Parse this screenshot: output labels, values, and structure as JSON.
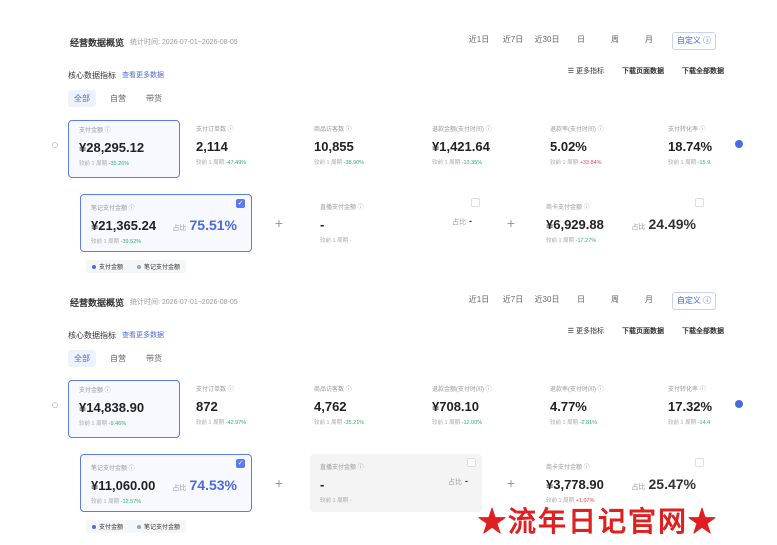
{
  "panels": [
    {
      "title": "经营数据概览",
      "stat_range": "统计时间: 2026-07-01~2026-08-05",
      "range_buttons": [
        "近1日",
        "近7日",
        "近30日",
        "日",
        "周",
        "月"
      ],
      "custom_button": "自定义 ⓘ",
      "sub_title": "核心数据指标",
      "sub_link": "查看更多数据",
      "actions": {
        "more_metrics": "☰ 更多指标",
        "download_page": "下载页面数据",
        "download_all": "下载全部数据"
      },
      "tabs": [
        "全部",
        "自营",
        "带货"
      ],
      "metrics": [
        {
          "label": "支付金额 ⓘ",
          "value": "¥28,295.12",
          "cmp_prefix": "较前 1 周期",
          "delta": "-35.26%"
        },
        {
          "label": "支付订单数 ⓘ",
          "value": "2,114",
          "cmp_prefix": "较前 1 周期",
          "delta": "-47.49%"
        },
        {
          "label": "商品访客数 ⓘ",
          "value": "10,855",
          "cmp_prefix": "较前 1 周期",
          "delta": "-38.90%"
        },
        {
          "label": "退款金额(支付时间) ⓘ",
          "value": "¥1,421.64",
          "cmp_prefix": "较前 1 周期",
          "delta": "-13.35%"
        },
        {
          "label": "退款率(支付时间) ⓘ",
          "value": "5.02%",
          "cmp_prefix": "较前 1 周期",
          "delta": "+33.84%"
        },
        {
          "label": "支付转化率 ⓘ",
          "value": "18.74%",
          "cmp_prefix": "较前 1 周期",
          "delta": "-15.9"
        }
      ],
      "sub_cards": [
        {
          "label": "笔记支付金额 ⓘ",
          "value": "¥21,365.24",
          "cmp": "较前 1 周期",
          "delta": "-39.52%",
          "share_label": "占比",
          "share": "75.51%"
        },
        {
          "label": "直播支付金额 ⓘ",
          "value": "-",
          "cmp": "较前 1 周期 -",
          "delta": "",
          "share_label": "占比",
          "share": "-"
        },
        {
          "label": "商卡支付金额 ⓘ",
          "value": "¥6,929.88",
          "cmp": "较前 1 周期",
          "delta": "-17.27%",
          "share_label": "占比",
          "share": "24.49%"
        }
      ],
      "legend": [
        "支付金额",
        "笔记支付金额"
      ]
    },
    {
      "title": "经营数据概览",
      "stat_range": "统计时间: 2026-07-01~2026-08-05",
      "range_buttons": [
        "近1日",
        "近7日",
        "近30日",
        "日",
        "周",
        "月"
      ],
      "custom_button": "自定义 ⓘ",
      "sub_title": "核心数据指标",
      "sub_link": "查看更多数据",
      "actions": {
        "more_metrics": "☰ 更多指标",
        "download_page": "下载页面数据",
        "download_all": "下载全部数据"
      },
      "tabs": [
        "全部",
        "自营",
        "带货"
      ],
      "metrics": [
        {
          "label": "支付金额 ⓘ",
          "value": "¥14,838.90",
          "cmp_prefix": "较前 1 周期",
          "delta": "-9.46%"
        },
        {
          "label": "支付订单数 ⓘ",
          "value": "872",
          "cmp_prefix": "较前 1 周期",
          "delta": "-42.97%"
        },
        {
          "label": "商品访客数 ⓘ",
          "value": "4,762",
          "cmp_prefix": "较前 1 周期",
          "delta": "-35.21%"
        },
        {
          "label": "退款金额(支付时间) ⓘ",
          "value": "¥708.10",
          "cmp_prefix": "较前 1 周期",
          "delta": "-12.00%"
        },
        {
          "label": "退款率(支付时间) ⓘ",
          "value": "4.77%",
          "cmp_prefix": "较前 1 周期",
          "delta": "-2.81%"
        },
        {
          "label": "支付转化率 ⓘ",
          "value": "17.32%",
          "cmp_prefix": "较前 1 周期",
          "delta": "-14.4"
        }
      ],
      "sub_cards": [
        {
          "label": "笔记支付金额 ⓘ",
          "value": "¥11,060.00",
          "cmp": "较前 1 周期",
          "delta": "-12.57%",
          "share_label": "占比",
          "share": "74.53%"
        },
        {
          "label": "直播支付金额 ⓘ",
          "value": "-",
          "cmp": "较前 1 周期 -",
          "delta": "",
          "share_label": "占比",
          "share": "-"
        },
        {
          "label": "商卡支付金额 ⓘ",
          "value": "¥3,778.90",
          "cmp": "较前 1 周期",
          "delta": "+1.07%",
          "share_label": "占比",
          "share": "25.47%"
        }
      ],
      "legend": [
        "支付金额",
        "笔记支付金额"
      ]
    }
  ],
  "watermark": "★流年日记官网★",
  "colors": {
    "accent": "#4a6be0",
    "down": "#2fae6b",
    "up": "#e04848",
    "watermark": "#e02020"
  }
}
